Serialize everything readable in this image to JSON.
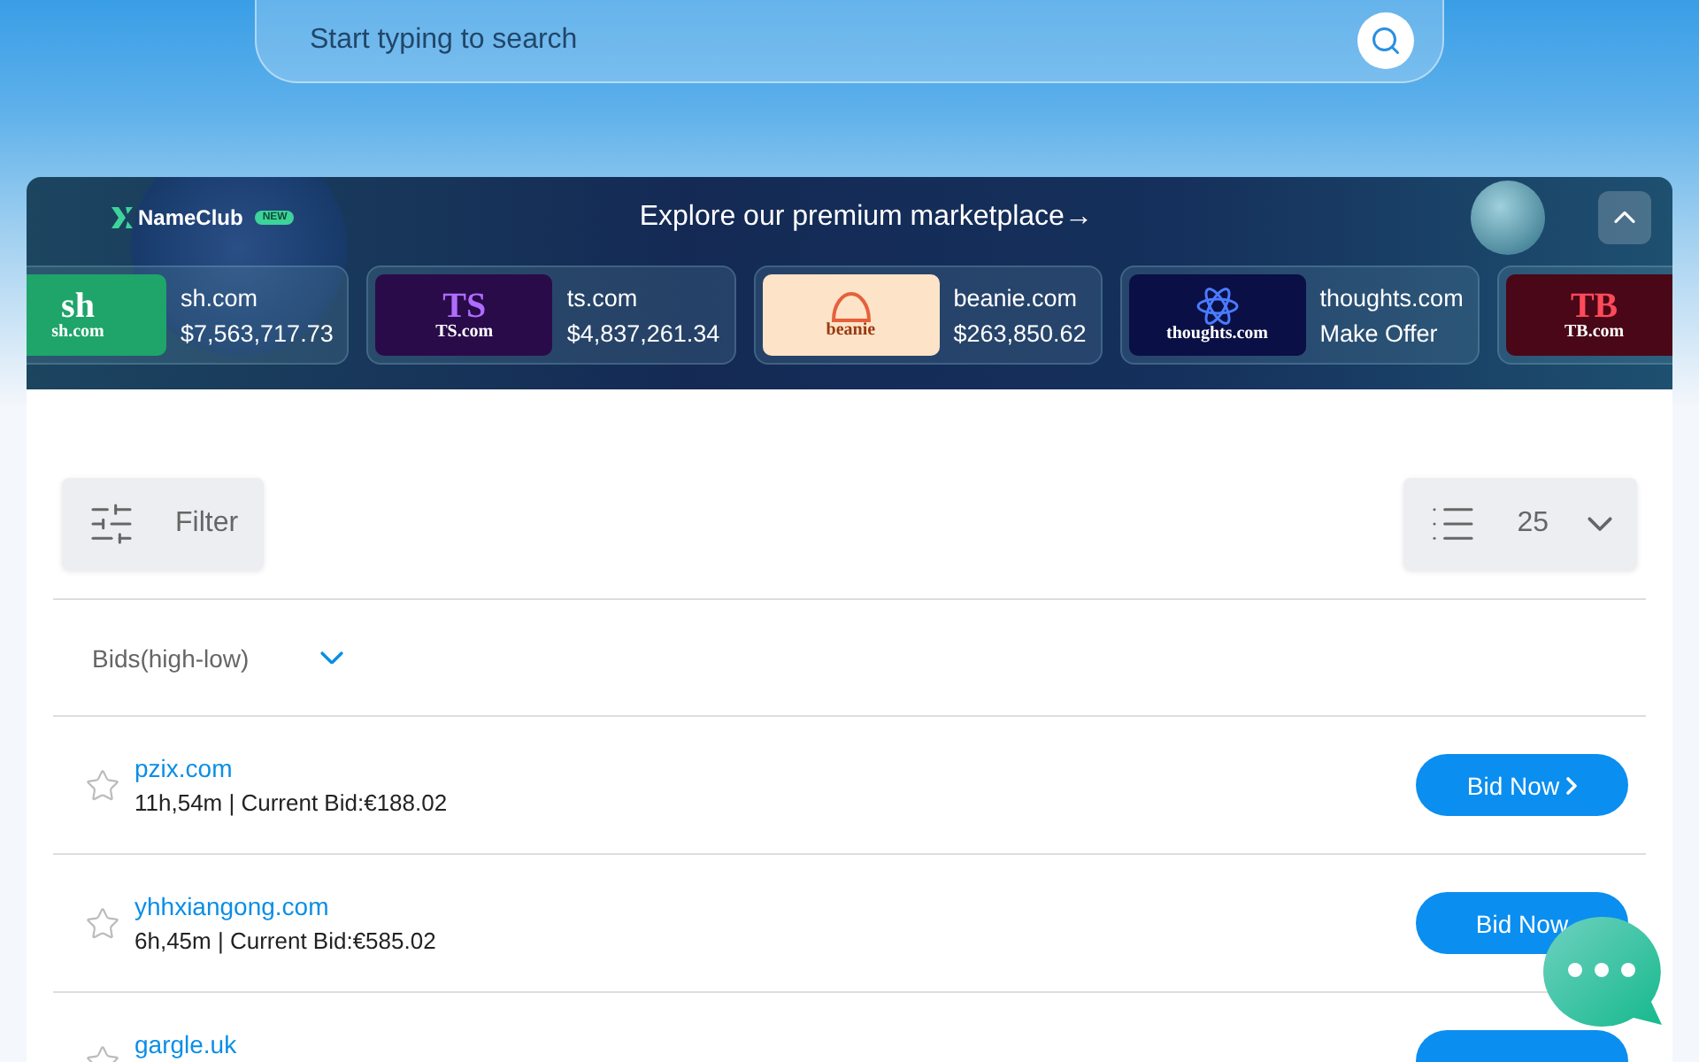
{
  "search": {
    "placeholder": "Start typing to search"
  },
  "banner": {
    "brand": "NameClub",
    "badge": "NEW",
    "headline": "Explore our premium marketplace→",
    "listings": [
      {
        "kind": "mark",
        "logo_text": "sh.com",
        "logo_mark": "sh",
        "name": "sh.com",
        "price": "$7,563,717.73",
        "color": "#1fa46a"
      },
      {
        "kind": "mark",
        "logo_text": "TS.com",
        "logo_mark": "TS",
        "name": "ts.com",
        "price": "$4,837,261.34",
        "color": "#2a0b4a"
      },
      {
        "kind": "hat",
        "logo_text": "beanie",
        "name": "beanie.com",
        "price": "$263,850.62",
        "color": "#fde3c8"
      },
      {
        "kind": "atom",
        "logo_text": "thoughts.com",
        "name": "thoughts.com",
        "price": "Make Offer",
        "color": "#0a0f45"
      },
      {
        "kind": "mark",
        "logo_text": "TB.com",
        "logo_mark": "TB",
        "color": "#4a0717"
      }
    ]
  },
  "toolbar": {
    "filter_label": "Filter",
    "page_size": "25"
  },
  "sort": {
    "label": "Bids(high-low)"
  },
  "auctions": [
    {
      "domain": "pzix.com",
      "details": "11h,54m | Current Bid:€188.02",
      "favorite": false,
      "action": "Bid Now"
    },
    {
      "domain": "yhhxiangong.com",
      "details": "6h,45m | Current Bid:€585.02",
      "favorite": false,
      "action": "Bid Now"
    },
    {
      "domain": "gargle.uk",
      "favorite": false
    }
  ]
}
